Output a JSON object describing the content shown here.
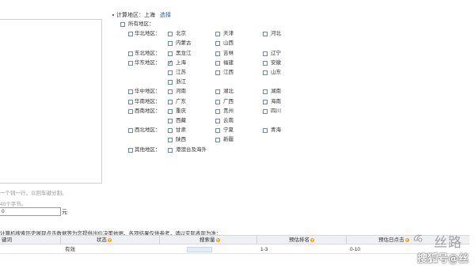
{
  "keyword_hint": "一个词一行，以回车键分割。",
  "length_hint": "40个字节。",
  "bid": {
    "value": "0",
    "unit": "元"
  },
  "region": {
    "title": "计算地区：上海",
    "select_label": "选择",
    "all_regions_label": "所有地区：",
    "groups": [
      {
        "label": "华北地区：",
        "checked": false,
        "cities": [
          {
            "name": "北京",
            "checked": false
          },
          {
            "name": "天津",
            "checked": false
          },
          {
            "name": "河北",
            "checked": false
          },
          {
            "name": "内蒙古",
            "checked": false
          },
          {
            "name": "山西",
            "checked": false
          }
        ]
      },
      {
        "label": "东北地区：",
        "checked": false,
        "cities": [
          {
            "name": "黑龙江",
            "checked": false
          },
          {
            "name": "吉林",
            "checked": false
          },
          {
            "name": "辽宁",
            "checked": false
          }
        ]
      },
      {
        "label": "华东地区：",
        "checked": false,
        "cities": [
          {
            "name": "上海",
            "checked": true
          },
          {
            "name": "福建",
            "checked": false
          },
          {
            "name": "安徽",
            "checked": false
          },
          {
            "name": "江苏",
            "checked": false
          },
          {
            "name": "江西",
            "checked": false
          },
          {
            "name": "山东",
            "checked": false
          },
          {
            "name": "浙江",
            "checked": false
          }
        ]
      },
      {
        "label": "华中地区：",
        "checked": false,
        "cities": [
          {
            "name": "河南",
            "checked": false
          },
          {
            "name": "湖北",
            "checked": false
          },
          {
            "name": "湖南",
            "checked": false
          }
        ]
      },
      {
        "label": "华南地区：",
        "checked": false,
        "cities": [
          {
            "name": "广东",
            "checked": false
          },
          {
            "name": "广西",
            "checked": false
          },
          {
            "name": "海南",
            "checked": false
          }
        ]
      },
      {
        "label": "西南地区：",
        "checked": false,
        "cities": [
          {
            "name": "重庆",
            "checked": false
          },
          {
            "name": "贵州",
            "checked": false
          },
          {
            "name": "四川",
            "checked": false
          },
          {
            "name": "西藏",
            "checked": false
          },
          {
            "name": "云南",
            "checked": false
          }
        ]
      },
      {
        "label": "西北地区：",
        "checked": false,
        "cities": [
          {
            "name": "甘肃",
            "checked": false
          },
          {
            "name": "宁夏",
            "checked": false
          },
          {
            "name": "青海",
            "checked": false
          },
          {
            "name": "陕西",
            "checked": false
          },
          {
            "name": "新疆",
            "checked": false
          }
        ]
      },
      {
        "label": "其他地区：",
        "checked": false,
        "cities": [
          {
            "name": "港澳台及海外",
            "checked": false
          }
        ]
      }
    ]
  },
  "note": "计算机搜索历史展现点击数据等为您提供出价决策依据，各项结果仅供参考，请以实际表现为准：",
  "table": {
    "headers": [
      "键词",
      "状态",
      "搜索量",
      "预估排名",
      "预估日点击"
    ],
    "rows": [
      {
        "keyword": "",
        "status": "有效",
        "volume_level": 0.4,
        "rank": "1-3",
        "clicks": "0-10"
      }
    ]
  },
  "watermark": {
    "line1": "丝路",
    "line2": "搜狐号@丝"
  }
}
